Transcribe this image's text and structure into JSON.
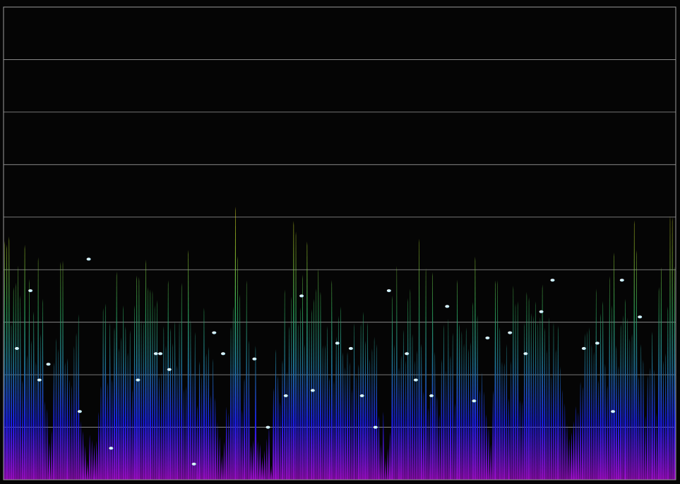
{
  "chart_data": {
    "type": "bar",
    "title": "",
    "xlabel": "",
    "ylabel": "",
    "x_count": 300,
    "ylim": [
      0,
      9
    ],
    "grid": true,
    "grid_lines": 9,
    "colors": {
      "background": "#050505",
      "grid": "#9a9a9a",
      "gradient": [
        "#9a0cc0",
        "#1a1ef0",
        "#1f7aa0",
        "#2ea858",
        "#9ad030",
        "#e8d418",
        "#e07a28"
      ]
    },
    "peaks": [
      5.4,
      5.4,
      4.2,
      4.4,
      3.3,
      4.6,
      4.3,
      3.2,
      4.5,
      5.1,
      1.5,
      1.0,
      2.9,
      3.1,
      4.8,
      3.3,
      2.7,
      3.0,
      4.5,
      1.2,
      0.8,
      1.2,
      0.9,
      1.3,
      3.9,
      3.6,
      3.0,
      3.4,
      5.0,
      5.4,
      4.6,
      4.1,
      3.8,
      4.2,
      4.8,
      5.0,
      4.3,
      4.2,
      4.0,
      3.1,
      4.9,
      3.8,
      2.8,
      4.1,
      4.6,
      3.4,
      4.8,
      3.5,
      2.8,
      3.4,
      4.1,
      4.0,
      2.6,
      1.8,
      0.9,
      1.0,
      1.6,
      4.1,
      5.2,
      3.6,
      2.8,
      3.8,
      1.2,
      2.9,
      0.8,
      0.7,
      1.0,
      0.6,
      2.8,
      2.6,
      3.9,
      3.2,
      4.0,
      5.2,
      5.5,
      5.3,
      5.5,
      5.4,
      4.6,
      4.3,
      4.0,
      3.2,
      4.1,
      3.2,
      4.5,
      3.3,
      2.8,
      3.6,
      3.1,
      4.3,
      3.2,
      3.0,
      2.7,
      3.2,
      2.6,
      1.3,
      0.6,
      1.1,
      3.8,
      4.6,
      3.4,
      4.2,
      4.3,
      4.5,
      4.8,
      3.5,
      4.7,
      3.0,
      4.2,
      2.7,
      3.6,
      4.2,
      3.1,
      3.0,
      3.8,
      4.5,
      3.9,
      3.4,
      4.3,
      4.7,
      3.2,
      1.8,
      1.0,
      1.8,
      3.8,
      3.6,
      4.2,
      2.9,
      4.1,
      3.4,
      2.6,
      3.4,
      4.0,
      3.5,
      4.2,
      3.1,
      4.0,
      3.1,
      4.4,
      3.7,
      2.8,
      1.8,
      1.6,
      1.4,
      2.0,
      2.6,
      2.8,
      3.5,
      3.3,
      3.8,
      3.4,
      4.1,
      3.5,
      4.2,
      4.4,
      3.5,
      3.5,
      3.4,
      4.9,
      5.0,
      3.2,
      3.2,
      2.0,
      3.3,
      2.8,
      4.9,
      4.1,
      3.3,
      5.0,
      4.8
    ],
    "highlight_marks": [
      [
        6,
        2.5
      ],
      [
        12,
        3.6
      ],
      [
        16,
        1.9
      ],
      [
        20,
        2.2
      ],
      [
        34,
        1.3
      ],
      [
        38,
        4.2
      ],
      [
        48,
        0.6
      ],
      [
        60,
        1.9
      ],
      [
        68,
        2.4
      ],
      [
        70,
        2.4
      ],
      [
        74,
        2.1
      ],
      [
        85,
        0.3
      ],
      [
        94,
        2.8
      ],
      [
        98,
        2.4
      ],
      [
        112,
        2.3
      ],
      [
        118,
        1.0
      ],
      [
        126,
        1.6
      ],
      [
        133,
        3.5
      ],
      [
        138,
        1.7
      ],
      [
        149,
        2.6
      ],
      [
        155,
        2.5
      ],
      [
        160,
        1.6
      ],
      [
        166,
        1.0
      ],
      [
        172,
        3.6
      ],
      [
        180,
        2.4
      ],
      [
        184,
        1.9
      ],
      [
        191,
        1.6
      ],
      [
        198,
        3.3
      ],
      [
        210,
        1.5
      ],
      [
        216,
        2.7
      ],
      [
        226,
        2.8
      ],
      [
        233,
        2.4
      ],
      [
        240,
        3.2
      ],
      [
        245,
        3.8
      ],
      [
        259,
        2.5
      ],
      [
        265,
        2.6
      ],
      [
        272,
        1.3
      ],
      [
        276,
        3.8
      ],
      [
        284,
        3.1
      ]
    ]
  }
}
